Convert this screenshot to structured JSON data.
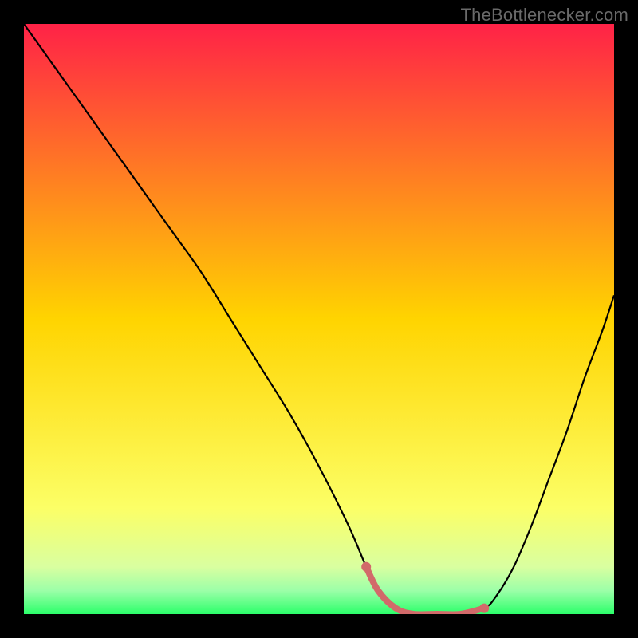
{
  "watermark": "TheBottlenecker.com",
  "chart_data": {
    "type": "line",
    "title": "",
    "xlabel": "",
    "ylabel": "",
    "xlim": [
      0,
      100
    ],
    "ylim": [
      0,
      100
    ],
    "legend": [],
    "background_gradient": {
      "stops": [
        {
          "offset": 0.0,
          "color": "#ff2247"
        },
        {
          "offset": 0.5,
          "color": "#ffd400"
        },
        {
          "offset": 0.82,
          "color": "#fcff66"
        },
        {
          "offset": 0.92,
          "color": "#d9ffa0"
        },
        {
          "offset": 0.96,
          "color": "#9cffa8"
        },
        {
          "offset": 1.0,
          "color": "#2cff6b"
        }
      ]
    },
    "series": [
      {
        "name": "bottleneck-curve",
        "color": "#000000",
        "x": [
          0,
          5,
          10,
          15,
          20,
          25,
          30,
          35,
          40,
          45,
          50,
          55,
          58,
          60,
          63,
          66,
          70,
          74,
          78,
          80,
          83,
          86,
          89,
          92,
          95,
          98,
          100
        ],
        "y": [
          100,
          93,
          86,
          79,
          72,
          65,
          58,
          50,
          42,
          34,
          25,
          15,
          8,
          4,
          1,
          0,
          0,
          0,
          1,
          3,
          8,
          15,
          23,
          31,
          40,
          48,
          54
        ]
      }
    ],
    "highlight": {
      "name": "optimal-range",
      "color": "#d26a6a",
      "endpoint_color": "#d26a6a",
      "x_range": [
        58,
        78
      ],
      "dots_x": [
        58,
        78
      ]
    }
  }
}
